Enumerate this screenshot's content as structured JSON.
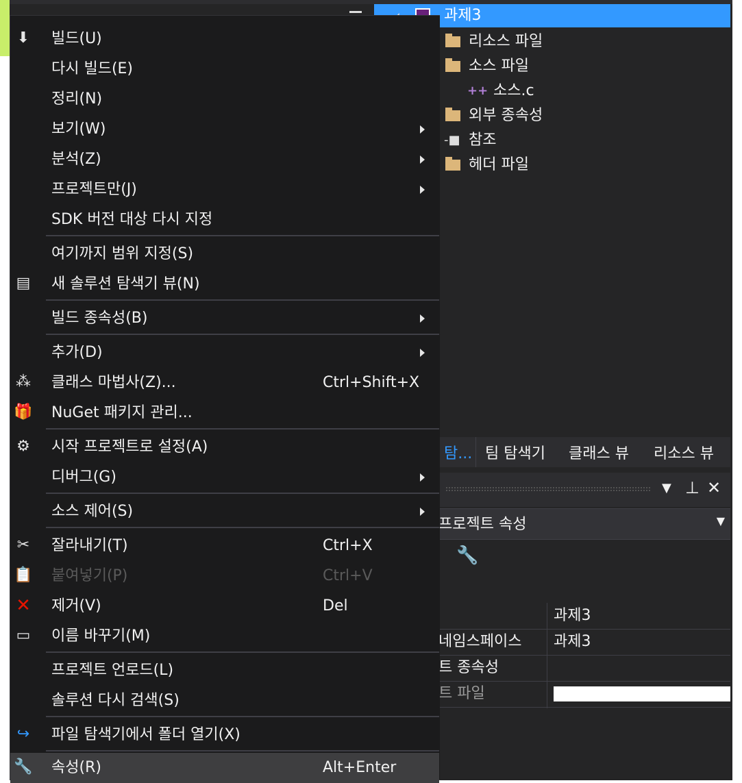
{
  "menu": {
    "items": [
      {
        "label": "빌드(U)",
        "shortcut": "",
        "submenu": false,
        "icon": "build-icon"
      },
      {
        "label": "다시 빌드(E)",
        "shortcut": "",
        "submenu": false,
        "icon": ""
      },
      {
        "label": "정리(N)",
        "shortcut": "",
        "submenu": false,
        "icon": ""
      },
      {
        "label": "보기(W)",
        "shortcut": "",
        "submenu": true,
        "icon": ""
      },
      {
        "label": "분석(Z)",
        "shortcut": "",
        "submenu": true,
        "icon": ""
      },
      {
        "label": "프로젝트만(J)",
        "shortcut": "",
        "submenu": true,
        "icon": ""
      },
      {
        "label": "SDK 버전 대상 다시 지정",
        "shortcut": "",
        "submenu": false,
        "icon": ""
      },
      {
        "label": "여기까지 범위 지정(S)",
        "shortcut": "",
        "submenu": false,
        "icon": ""
      },
      {
        "label": "새 솔루션 탐색기 뷰(N)",
        "shortcut": "",
        "submenu": false,
        "icon": "new-view-icon"
      },
      {
        "label": "빌드 종속성(B)",
        "shortcut": "",
        "submenu": true,
        "icon": ""
      },
      {
        "label": "추가(D)",
        "shortcut": "",
        "submenu": true,
        "icon": ""
      },
      {
        "label": "클래스 마법사(Z)...",
        "shortcut": "Ctrl+Shift+X",
        "submenu": false,
        "icon": "class-wizard-icon"
      },
      {
        "label": "NuGet 패키지 관리...",
        "shortcut": "",
        "submenu": false,
        "icon": "nuget-package-icon"
      },
      {
        "label": "시작 프로젝트로 설정(A)",
        "shortcut": "",
        "submenu": false,
        "icon": "gear-icon"
      },
      {
        "label": "디버그(G)",
        "shortcut": "",
        "submenu": true,
        "icon": ""
      },
      {
        "label": "소스 제어(S)",
        "shortcut": "",
        "submenu": true,
        "icon": ""
      },
      {
        "label": "잘라내기(T)",
        "shortcut": "Ctrl+X",
        "submenu": false,
        "icon": "scissors-icon"
      },
      {
        "label": "붙여넣기(P)",
        "shortcut": "Ctrl+V",
        "submenu": false,
        "icon": "paste-icon",
        "disabled": true
      },
      {
        "label": "제거(V)",
        "shortcut": "Del",
        "submenu": false,
        "icon": "remove-x-icon"
      },
      {
        "label": "이름 바꾸기(M)",
        "shortcut": "",
        "submenu": false,
        "icon": "rename-icon"
      },
      {
        "label": "프로젝트 언로드(L)",
        "shortcut": "",
        "submenu": false,
        "icon": ""
      },
      {
        "label": "솔루션 다시 검색(S)",
        "shortcut": "",
        "submenu": false,
        "icon": ""
      },
      {
        "label": "파일 탐색기에서 폴더 열기(X)",
        "shortcut": "",
        "submenu": false,
        "icon": "open-folder-arrow-icon"
      },
      {
        "label": "속성(R)",
        "shortcut": "Alt+Enter",
        "submenu": false,
        "icon": "wrench-icon",
        "highlighted": true
      }
    ]
  },
  "tree": {
    "project": "과제3",
    "nodes": [
      "리소스 파일",
      "소스 파일",
      "소스.c",
      "외부 종속성",
      "참조",
      "헤더 파일"
    ]
  },
  "tabs": [
    "탐...",
    "팀 탐색기",
    "클래스 뷰",
    "리소스 뷰"
  ],
  "properties": {
    "combo": "프로젝트 속성",
    "rows": [
      {
        "key": "",
        "value": "과제3"
      },
      {
        "key": "네임스페이스",
        "value": "과제3"
      },
      {
        "key": "트 종속성",
        "value": ""
      },
      {
        "key": "트 파일",
        "value": ""
      }
    ]
  },
  "colors": {
    "accent": "#3399ff",
    "menu_bg": "#1b1b1c",
    "highlight": "#3e3e40",
    "folder": "#dcb67a",
    "remove": "#e51400"
  }
}
